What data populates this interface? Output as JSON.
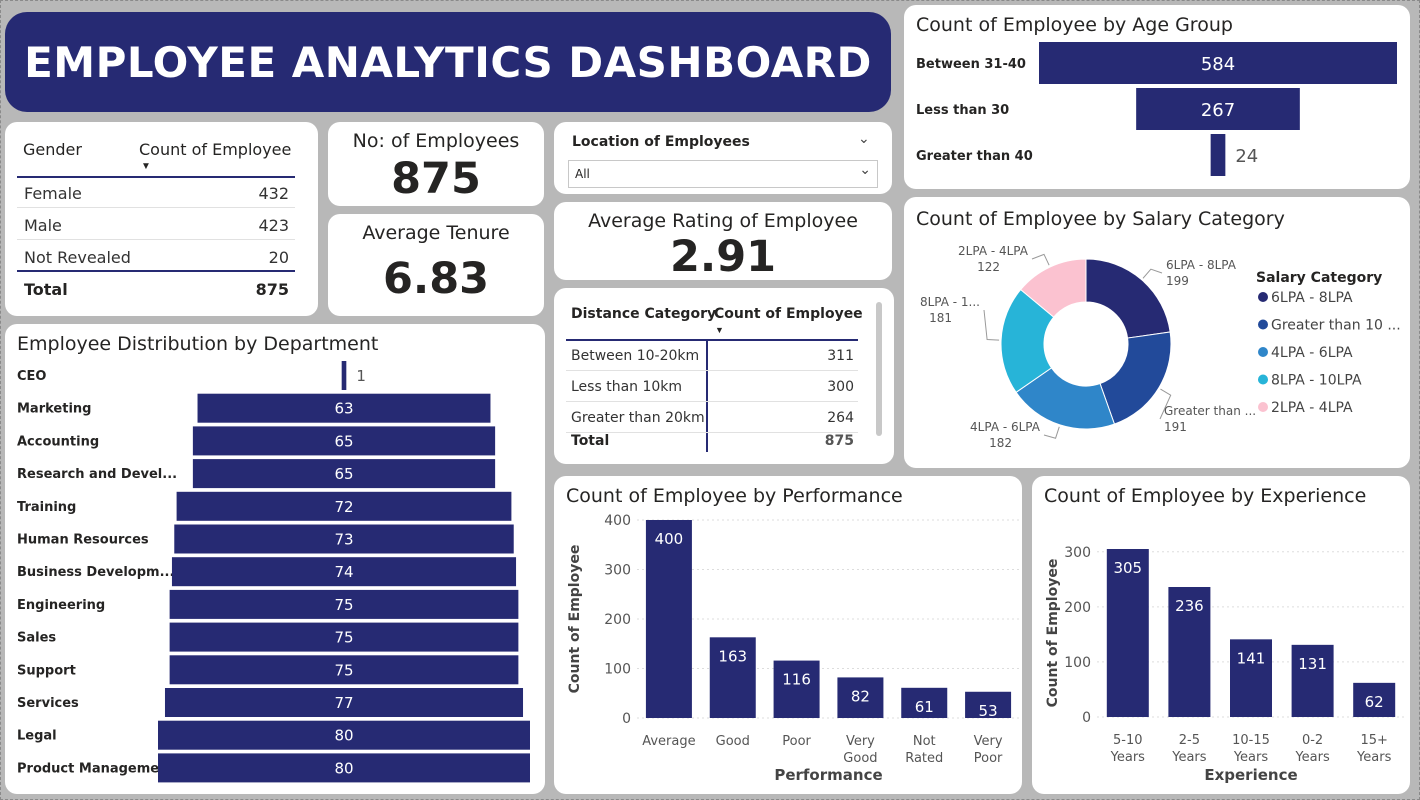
{
  "title": "EMPLOYEE ANALYTICS DASHBOARD",
  "colors": {
    "bar": "#262a73",
    "navy": "#1f2a6e",
    "card": "#ffffff",
    "background": "#b8b8b8"
  },
  "gender_table": {
    "headers": [
      "Gender",
      "Count of Employee"
    ],
    "rows": [
      [
        "Female",
        "432"
      ],
      [
        "Male",
        "423"
      ],
      [
        "Not Revealed",
        "20"
      ]
    ],
    "total": [
      "Total",
      "875"
    ]
  },
  "kpis": {
    "employees_label": "No: of Employees",
    "employees_value": "875",
    "tenure_label": "Average Tenure",
    "tenure_value": "6.83",
    "rating_label": "Average Rating of Employee",
    "rating_value": "2.91"
  },
  "location_filter": {
    "label": "Location of Employees",
    "value": "All"
  },
  "distance_table": {
    "headers": [
      "Distance Category",
      "Count of Employee"
    ],
    "rows": [
      [
        "Between 10-20km",
        "311"
      ],
      [
        "Less than 10km",
        "300"
      ],
      [
        "Greater than 20km",
        "264"
      ]
    ],
    "total": [
      "Total",
      "875"
    ]
  },
  "chart_data": [
    {
      "type": "bar",
      "orientation": "horizontal",
      "style": "centered-funnel",
      "title": "Count of Employee by Age Group",
      "categories": [
        "Between 31-40",
        "Less than 30",
        "Greater than 40"
      ],
      "values": [
        584,
        267,
        24
      ]
    },
    {
      "type": "pie",
      "style": "donut",
      "title": "Count of Employee by Salary Category",
      "legend_title": "Salary Category",
      "legend_position": "right",
      "categories": [
        "6LPA - 8LPA",
        "Greater than 10 ...",
        "4LPA - 6LPA",
        "8LPA - 10LPA",
        "2LPA - 4LPA"
      ],
      "values": [
        199,
        191,
        182,
        181,
        122
      ],
      "slice_labels": [
        "6LPA - 8LPA",
        "Greater than ...",
        "4LPA - 6LPA",
        "8LPA - 1...",
        "2LPA - 4LPA"
      ],
      "colors": [
        "#262a73",
        "#224a9a",
        "#2f86c9",
        "#27b4d8",
        "#fbc2d0"
      ]
    },
    {
      "type": "bar",
      "orientation": "horizontal",
      "style": "centered-funnel",
      "title": "Employee Distribution by Department",
      "categories": [
        "CEO",
        "Marketing",
        "Accounting",
        "Research and Devel...",
        "Training",
        "Human Resources",
        "Business Developm...",
        "Engineering",
        "Sales",
        "Support",
        "Services",
        "Legal",
        "Product Management"
      ],
      "values": [
        1,
        63,
        65,
        65,
        72,
        73,
        74,
        75,
        75,
        75,
        77,
        80,
        80
      ]
    },
    {
      "type": "bar",
      "title": "Count of Employee by Performance",
      "xlabel": "Performance",
      "ylabel": "Count of Employee",
      "categories": [
        "Average",
        "Good",
        "Poor",
        "Very Good",
        "Not Rated",
        "Very Poor"
      ],
      "values": [
        400,
        163,
        116,
        82,
        61,
        53
      ],
      "ylim": [
        0,
        400
      ],
      "yticks": [
        0,
        100,
        200,
        300,
        400
      ],
      "grid": true
    },
    {
      "type": "bar",
      "title": "Count of Employee by Experience",
      "xlabel": "Experience",
      "ylabel": "Count of Employee",
      "categories": [
        "5-10 Years",
        "2-5 Years",
        "10-15 Years",
        "0-2 Years",
        "15+ Years"
      ],
      "values": [
        305,
        236,
        141,
        131,
        62
      ],
      "ylim": [
        0,
        305
      ],
      "yticks": [
        0,
        100,
        200,
        300
      ],
      "grid": true
    }
  ]
}
